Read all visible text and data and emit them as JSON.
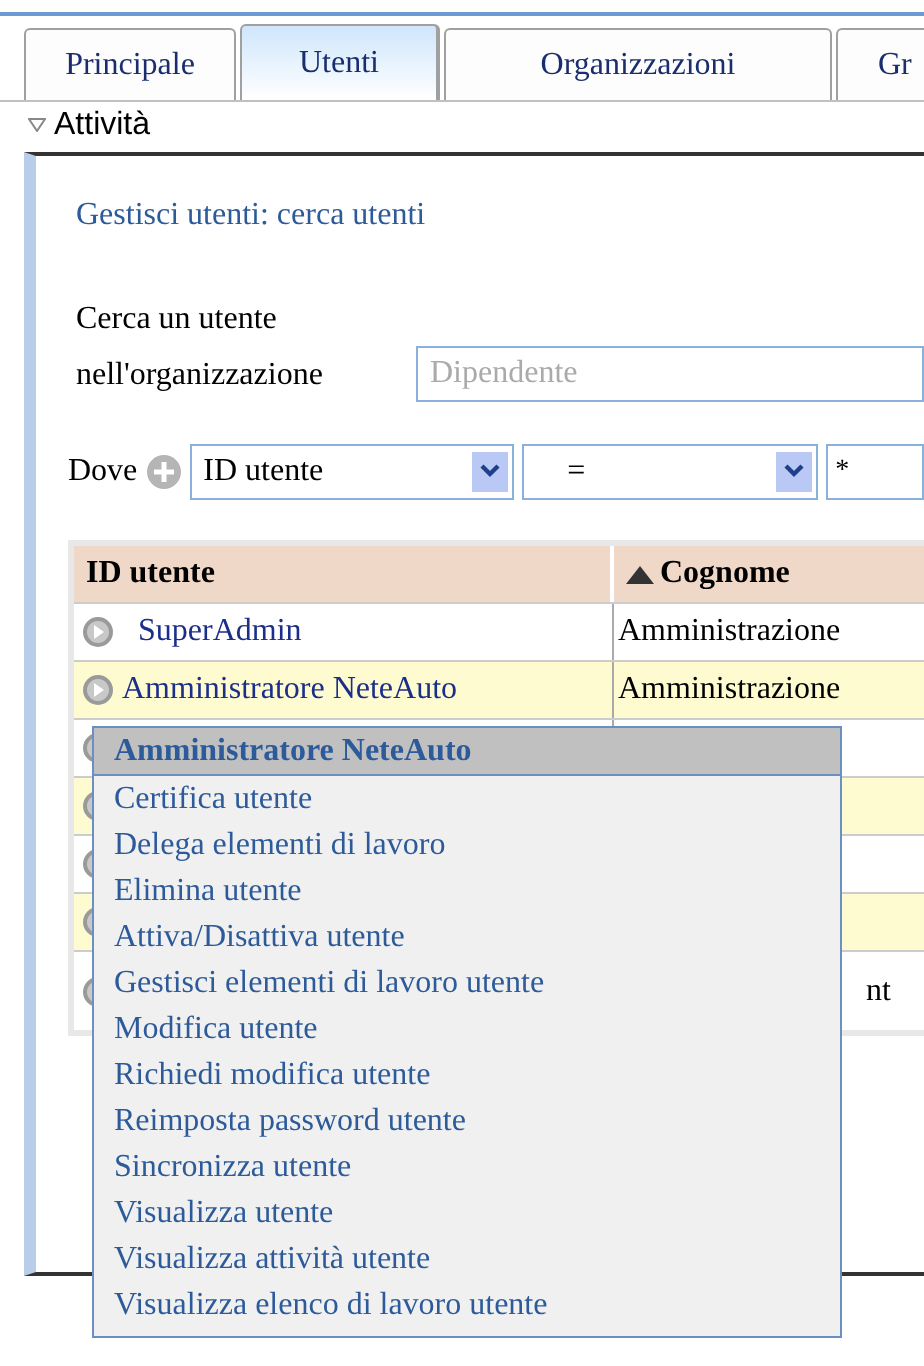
{
  "tabs": [
    {
      "label": "Principale",
      "selected": false
    },
    {
      "label": "Utenti",
      "selected": true
    },
    {
      "label": "Organizzazioni",
      "selected": false
    },
    {
      "label": "Gr",
      "selected": false
    }
  ],
  "section": {
    "title": "Attività",
    "expanded": true
  },
  "panel": {
    "heading": "Gestisci utenti: cerca utenti",
    "org_label": "Cerca un utente nell'organizzazione",
    "org_field": {
      "placeholder": "Dipendente"
    },
    "where_label": "Dove",
    "attribute_select": "ID utente",
    "operator_select": "=",
    "value_field": "*"
  },
  "table": {
    "columns": [
      {
        "label": "ID utente",
        "sorted": false
      },
      {
        "label": "Cognome",
        "sorted": true
      }
    ],
    "rows": [
      {
        "id": "SuperAdmin",
        "cognome": "Amministrazione"
      },
      {
        "id": "Amministratore NeteAuto",
        "cognome": "Amministrazione"
      },
      {},
      {},
      {},
      {},
      {
        "cognome": "nt"
      }
    ]
  },
  "context_menu": {
    "title": "Amministratore NeteAuto",
    "items": [
      "Certifica utente",
      "Delega elementi di lavoro",
      "Elimina utente",
      "Attiva/Disattiva utente",
      "Gestisci elementi di lavoro utente",
      "Modifica utente",
      "Richiedi modifica utente",
      "Reimposta password utente",
      "Sincronizza utente",
      "Visualizza utente",
      "Visualizza attività utente",
      "Visualizza elenco di lavoro utente"
    ]
  }
}
